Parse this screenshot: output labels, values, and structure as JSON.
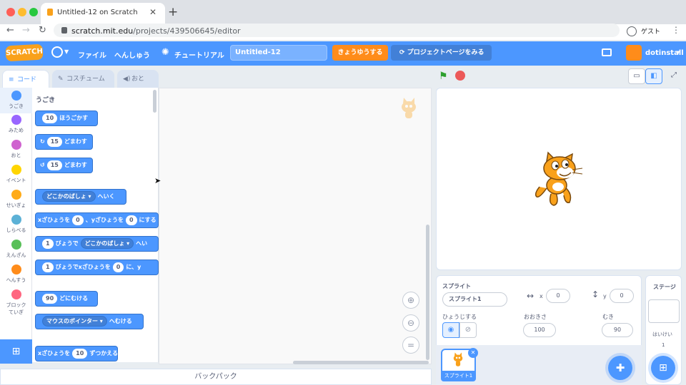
{
  "browser": {
    "tab_title": "Untitled-12 on Scratch",
    "url_host": "scratch.mit.edu",
    "url_path": "/projects/439506645/editor",
    "profile_label": "ゲスト"
  },
  "menu": {
    "logo": "SCRATCH",
    "file": "ファイル",
    "edit": "へんしゅう",
    "tutorials": "チュートリアル",
    "project_title": "Untitled-12",
    "share": "きょうゆうする",
    "project_page": "プロジェクトページをみる",
    "username": "dotinstall"
  },
  "tabs": {
    "code": "コード",
    "costumes": "コスチューム",
    "sounds": "おと"
  },
  "categories": [
    {
      "label": "うごき",
      "color": "#4c97ff"
    },
    {
      "label": "みため",
      "color": "#9966ff"
    },
    {
      "label": "おと",
      "color": "#cf63cf"
    },
    {
      "label": "イベント",
      "color": "#ffd500"
    },
    {
      "label": "せいぎょ",
      "color": "#ffab19"
    },
    {
      "label": "しらべる",
      "color": "#5cb1d6"
    },
    {
      "label": "えんざん",
      "color": "#59c059"
    },
    {
      "label": "へんすう",
      "color": "#ff8c1a"
    },
    {
      "label": "ブロックていぎ",
      "color": "#ff6680"
    }
  ],
  "palette": {
    "heading": "うごき",
    "move_steps": "10",
    "move_label": "ほうごかす",
    "turn_right_deg": "15",
    "turn_right_label": "どまわす",
    "turn_left_deg": "15",
    "turn_left_label": "どまわす",
    "goto_target": "どこかのばしょ",
    "goto_label": "へいく",
    "gotoxy_x_label": "xざひょうを",
    "gotoxy_x": "0",
    "gotoxy_y_label": "、yざひょうを",
    "gotoxy_y": "0",
    "gotoxy_tail": "にする",
    "glide_secs": "1",
    "glide_label": "びょうで",
    "glide_target": "どこかのばしょ",
    "glide_tail": "へい",
    "glidexy_secs": "1",
    "glidexy_label": "びょうでxざひょうを",
    "glidexy_x": "0",
    "glidexy_tail": "に、y",
    "point_dir": "90",
    "point_label": "どにむける",
    "point_towards_target": "マウスのポインター",
    "point_towards_label": "へむける",
    "changex_label": "xざひょうを",
    "changex_val": "10",
    "changex_tail": "ずつかえる"
  },
  "backpack": "バックパック",
  "sprite_info": {
    "sprite_label": "スプライト",
    "sprite_name": "スプライト1",
    "x_label": "x",
    "x": "0",
    "y_label": "y",
    "y": "0",
    "show_label": "ひょうじする",
    "size_label": "おおきさ",
    "size": "100",
    "direction_label": "むき",
    "direction": "90",
    "thumb_label": "スプライト1"
  },
  "stage_pane": {
    "title": "ステージ",
    "backdrops_label": "はいけい",
    "backdrops_count": "1"
  }
}
